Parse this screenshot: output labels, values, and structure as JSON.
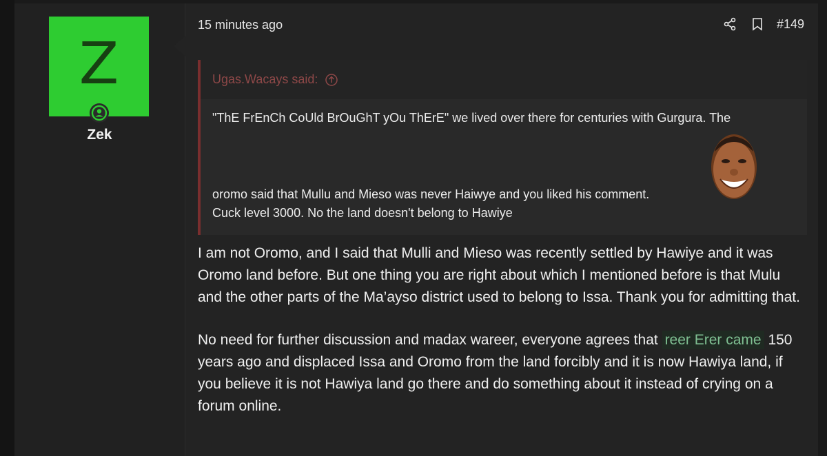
{
  "user": {
    "avatar_letter": "Z",
    "username": "Zek",
    "avatar_color": "#2ecc31"
  },
  "post": {
    "time": "15 minutes ago",
    "number": "#149",
    "icons": [
      "share-icon",
      "bookmark-icon"
    ]
  },
  "quote": {
    "author_label": "Ugas.Wacays said:",
    "line1": "\"ThE FrEnCh CoUld BrOuGhT yOu ThErE\" we lived over there for centuries with Gurgura. The",
    "line2a": "oromo said that Mullu and Mieso was never Haiwye and you liked his comment.",
    "line2b": "Cuck level 3000. No the land doesn't belong to Hawiye"
  },
  "body": {
    "p1": "I am not Oromo, and I said that Mulli and Mieso was recently settled by Hawiye and it was Oromo land before. But one thing you are right about which I mentioned before is that Mulu and the other parts of the Ma’ayso district used to belong to Issa. Thank you for admitting that.",
    "p2_before": "No need for further discussion and madax wareer, everyone agrees that ",
    "p2_highlight": "reer Erer came",
    "p2_after": " 150 years ago and displaced Issa and Oromo from the land forcibly and it is now Hawiya land, if you believe it is not Hawiya land go there and do something about it instead of crying on a forum online."
  }
}
